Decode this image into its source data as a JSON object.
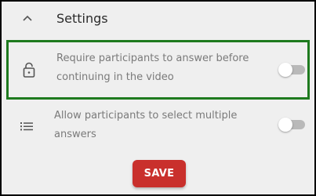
{
  "header": {
    "title": "Settings",
    "collapse_icon": "chevron-up-icon"
  },
  "settings": [
    {
      "icon": "lock-icon",
      "label": "Require participants to answer before continuing in the video",
      "enabled": false,
      "highlighted": true
    },
    {
      "icon": "list-icon",
      "label": "Allow participants to select multiple answers",
      "enabled": false,
      "highlighted": false
    }
  ],
  "actions": {
    "save_label": "SAVE"
  },
  "colors": {
    "panel_bg": "#efefef",
    "highlight_border": "#1e7a1e",
    "save_bg": "#c9302c",
    "toggle_track": "#b9b9b9"
  }
}
